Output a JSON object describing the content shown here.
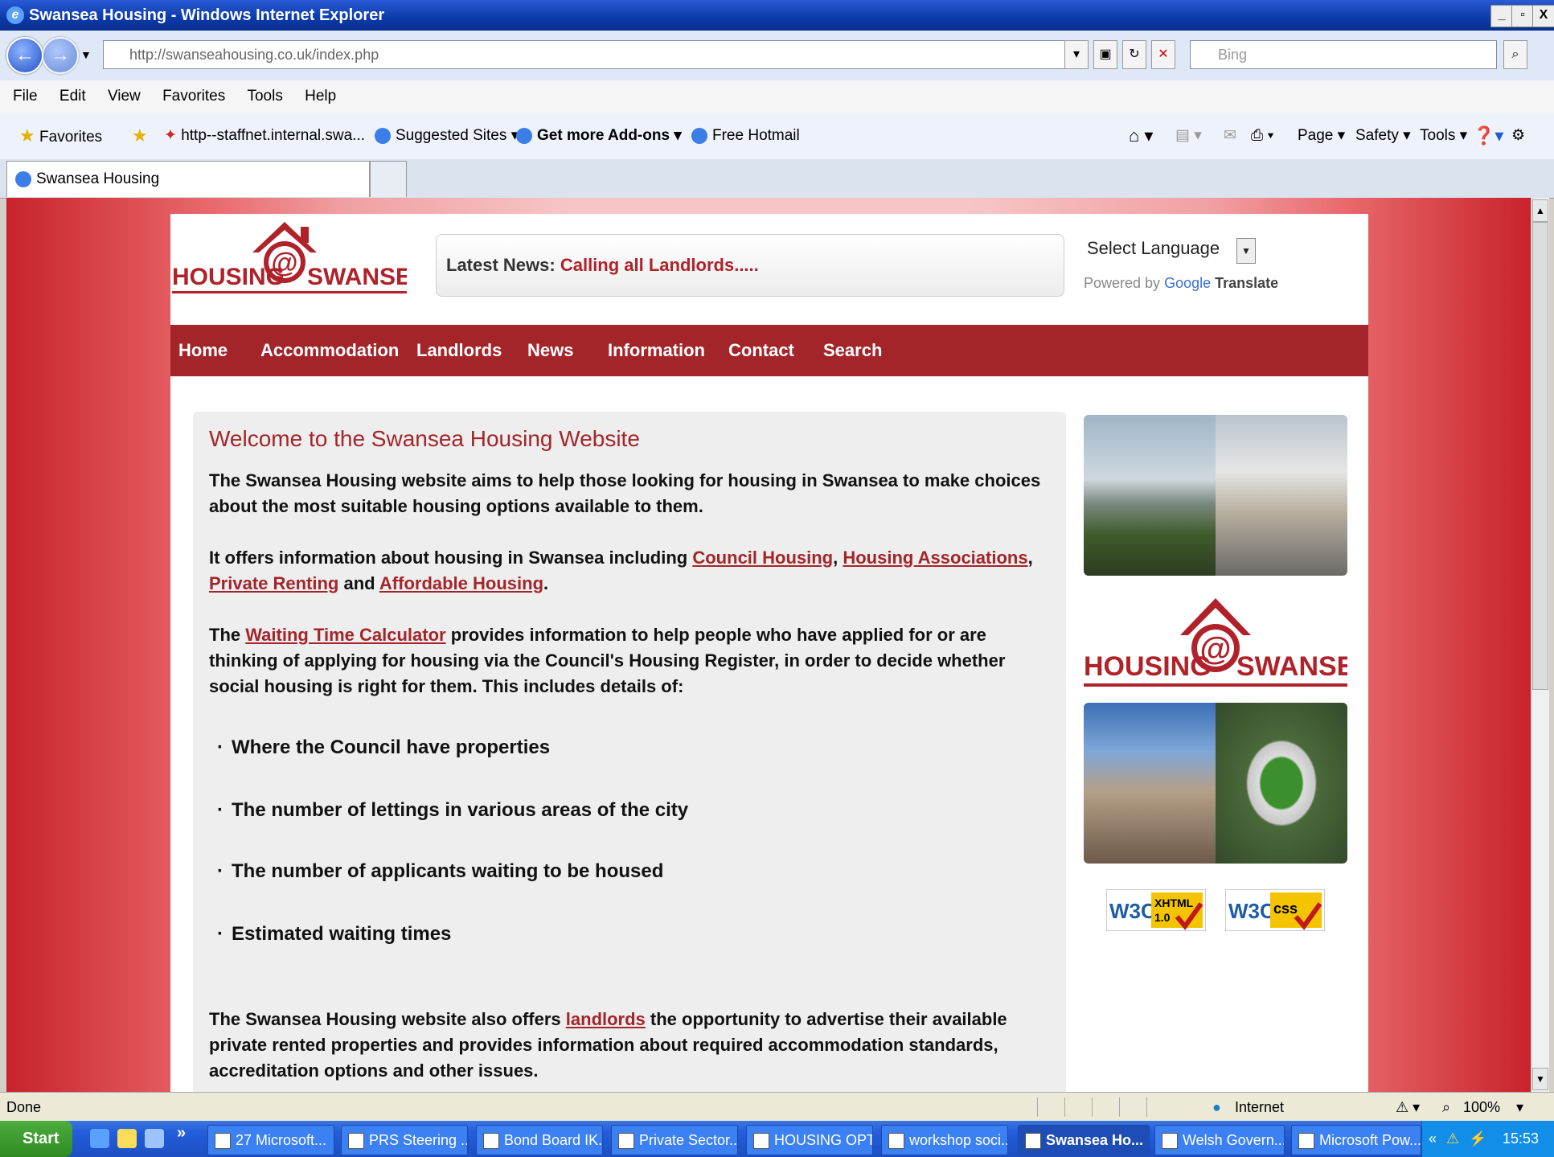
{
  "window": {
    "title": "Swansea Housing - Windows Internet Explorer",
    "controls": [
      "_",
      "▫",
      "X"
    ]
  },
  "browser": {
    "url": "http://swanseahousing.co.uk/index.php",
    "search_placeholder": "Bing",
    "menu": [
      "File",
      "Edit",
      "View",
      "Favorites",
      "Tools",
      "Help"
    ],
    "favorites_bar": {
      "favorites_label": "Favorites",
      "links": [
        "http--staffnet.internal.swa...",
        "Suggested Sites ▾",
        "Get more Add-ons ▾",
        "Free Hotmail"
      ],
      "commands": [
        "Page ▾",
        "Safety ▾",
        "Tools ▾"
      ]
    },
    "tab": "Swansea Housing"
  },
  "site": {
    "logo_text_left": "HOUSING",
    "logo_text_right": "SWANSEA",
    "latest_news_label": "Latest News:",
    "latest_news_link": "Calling all Landlords.....",
    "language": {
      "select_label": "Select Language",
      "powered_by": "Powered by",
      "google": "Google",
      "translate": "Translate"
    },
    "nav": [
      "Home",
      "Accommodation",
      "Landlords",
      "News",
      "Information",
      "Contact",
      "Search"
    ],
    "heading": "Welcome to the Swansea Housing Website",
    "para1": "The Swansea Housing website aims to help those looking for housing in Swansea to make choices about the most suitable housing options available to them.",
    "para2": {
      "before": "It offers information about housing in Swansea including ",
      "link1": "Council Housing",
      "sep1": ", ",
      "link2": "Housing Associations",
      "sep2": ", ",
      "link3": "Private Renting",
      "mid": " and ",
      "link4": "Affordable Housing",
      "after": "."
    },
    "para3": {
      "before": "The ",
      "link": "Waiting Time Calculator",
      "after": " provides information to help people who have applied for or are thinking of applying for housing via the Council's Housing Register, in order to decide whether social housing is right for them. This includes details of:"
    },
    "bullets": [
      "Where the Council have properties",
      "The number of lettings in various areas of the city",
      "The number of applicants waiting to be housed",
      "Estimated waiting times"
    ],
    "para4": {
      "before": "The Swansea Housing website also offers ",
      "link": "landlords",
      "after": " the opportunity to advertise their available private rented properties and provides information about required accommodation standards, accreditation options and other issues."
    },
    "badges": [
      "W3C XHTML 1.0",
      "W3C CSS"
    ],
    "badge_w3c": "W3C",
    "badge_xhtml": "XHTML",
    "badge_ver": "1.0",
    "badge_css": "css"
  },
  "status": {
    "text": "Done",
    "zone": "Internet",
    "zoom": "100%"
  },
  "taskbar": {
    "start": "Start",
    "tasks": [
      "27 Microsoft...",
      "PRS Steering ...",
      "Bond Board IK...",
      "Private Sector...",
      "HOUSING OPT...",
      "workshop soci...",
      "Swansea Ho...",
      "Welsh Govern...",
      "Microsoft Pow..."
    ],
    "clock": "15:53"
  },
  "colors": {
    "brand_red": "#a3252a",
    "nav_bg": "#a3252a",
    "link": "#a3252a"
  }
}
